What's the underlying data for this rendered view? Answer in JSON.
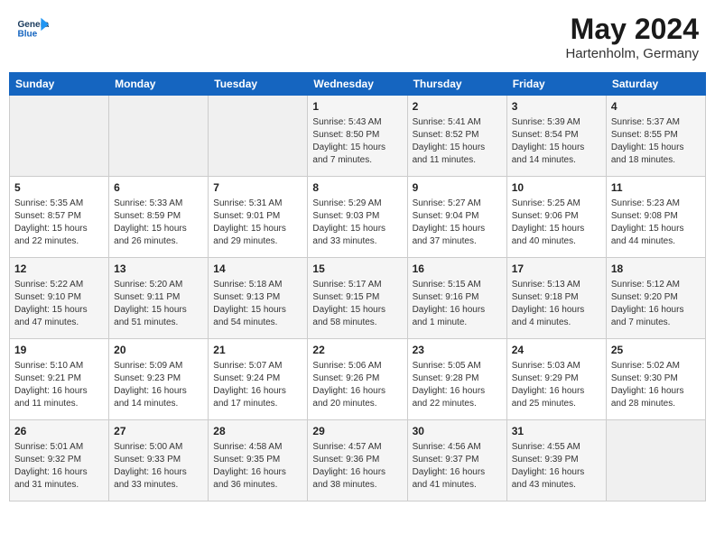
{
  "header": {
    "logo_line1": "General",
    "logo_line2": "Blue",
    "month_year": "May 2024",
    "location": "Hartenholm, Germany"
  },
  "days_of_week": [
    "Sunday",
    "Monday",
    "Tuesday",
    "Wednesday",
    "Thursday",
    "Friday",
    "Saturday"
  ],
  "weeks": [
    [
      {
        "day": "",
        "content": ""
      },
      {
        "day": "",
        "content": ""
      },
      {
        "day": "",
        "content": ""
      },
      {
        "day": "1",
        "content": "Sunrise: 5:43 AM\nSunset: 8:50 PM\nDaylight: 15 hours\nand 7 minutes."
      },
      {
        "day": "2",
        "content": "Sunrise: 5:41 AM\nSunset: 8:52 PM\nDaylight: 15 hours\nand 11 minutes."
      },
      {
        "day": "3",
        "content": "Sunrise: 5:39 AM\nSunset: 8:54 PM\nDaylight: 15 hours\nand 14 minutes."
      },
      {
        "day": "4",
        "content": "Sunrise: 5:37 AM\nSunset: 8:55 PM\nDaylight: 15 hours\nand 18 minutes."
      }
    ],
    [
      {
        "day": "5",
        "content": "Sunrise: 5:35 AM\nSunset: 8:57 PM\nDaylight: 15 hours\nand 22 minutes."
      },
      {
        "day": "6",
        "content": "Sunrise: 5:33 AM\nSunset: 8:59 PM\nDaylight: 15 hours\nand 26 minutes."
      },
      {
        "day": "7",
        "content": "Sunrise: 5:31 AM\nSunset: 9:01 PM\nDaylight: 15 hours\nand 29 minutes."
      },
      {
        "day": "8",
        "content": "Sunrise: 5:29 AM\nSunset: 9:03 PM\nDaylight: 15 hours\nand 33 minutes."
      },
      {
        "day": "9",
        "content": "Sunrise: 5:27 AM\nSunset: 9:04 PM\nDaylight: 15 hours\nand 37 minutes."
      },
      {
        "day": "10",
        "content": "Sunrise: 5:25 AM\nSunset: 9:06 PM\nDaylight: 15 hours\nand 40 minutes."
      },
      {
        "day": "11",
        "content": "Sunrise: 5:23 AM\nSunset: 9:08 PM\nDaylight: 15 hours\nand 44 minutes."
      }
    ],
    [
      {
        "day": "12",
        "content": "Sunrise: 5:22 AM\nSunset: 9:10 PM\nDaylight: 15 hours\nand 47 minutes."
      },
      {
        "day": "13",
        "content": "Sunrise: 5:20 AM\nSunset: 9:11 PM\nDaylight: 15 hours\nand 51 minutes."
      },
      {
        "day": "14",
        "content": "Sunrise: 5:18 AM\nSunset: 9:13 PM\nDaylight: 15 hours\nand 54 minutes."
      },
      {
        "day": "15",
        "content": "Sunrise: 5:17 AM\nSunset: 9:15 PM\nDaylight: 15 hours\nand 58 minutes."
      },
      {
        "day": "16",
        "content": "Sunrise: 5:15 AM\nSunset: 9:16 PM\nDaylight: 16 hours\nand 1 minute."
      },
      {
        "day": "17",
        "content": "Sunrise: 5:13 AM\nSunset: 9:18 PM\nDaylight: 16 hours\nand 4 minutes."
      },
      {
        "day": "18",
        "content": "Sunrise: 5:12 AM\nSunset: 9:20 PM\nDaylight: 16 hours\nand 7 minutes."
      }
    ],
    [
      {
        "day": "19",
        "content": "Sunrise: 5:10 AM\nSunset: 9:21 PM\nDaylight: 16 hours\nand 11 minutes."
      },
      {
        "day": "20",
        "content": "Sunrise: 5:09 AM\nSunset: 9:23 PM\nDaylight: 16 hours\nand 14 minutes."
      },
      {
        "day": "21",
        "content": "Sunrise: 5:07 AM\nSunset: 9:24 PM\nDaylight: 16 hours\nand 17 minutes."
      },
      {
        "day": "22",
        "content": "Sunrise: 5:06 AM\nSunset: 9:26 PM\nDaylight: 16 hours\nand 20 minutes."
      },
      {
        "day": "23",
        "content": "Sunrise: 5:05 AM\nSunset: 9:28 PM\nDaylight: 16 hours\nand 22 minutes."
      },
      {
        "day": "24",
        "content": "Sunrise: 5:03 AM\nSunset: 9:29 PM\nDaylight: 16 hours\nand 25 minutes."
      },
      {
        "day": "25",
        "content": "Sunrise: 5:02 AM\nSunset: 9:30 PM\nDaylight: 16 hours\nand 28 minutes."
      }
    ],
    [
      {
        "day": "26",
        "content": "Sunrise: 5:01 AM\nSunset: 9:32 PM\nDaylight: 16 hours\nand 31 minutes."
      },
      {
        "day": "27",
        "content": "Sunrise: 5:00 AM\nSunset: 9:33 PM\nDaylight: 16 hours\nand 33 minutes."
      },
      {
        "day": "28",
        "content": "Sunrise: 4:58 AM\nSunset: 9:35 PM\nDaylight: 16 hours\nand 36 minutes."
      },
      {
        "day": "29",
        "content": "Sunrise: 4:57 AM\nSunset: 9:36 PM\nDaylight: 16 hours\nand 38 minutes."
      },
      {
        "day": "30",
        "content": "Sunrise: 4:56 AM\nSunset: 9:37 PM\nDaylight: 16 hours\nand 41 minutes."
      },
      {
        "day": "31",
        "content": "Sunrise: 4:55 AM\nSunset: 9:39 PM\nDaylight: 16 hours\nand 43 minutes."
      },
      {
        "day": "",
        "content": ""
      }
    ]
  ]
}
